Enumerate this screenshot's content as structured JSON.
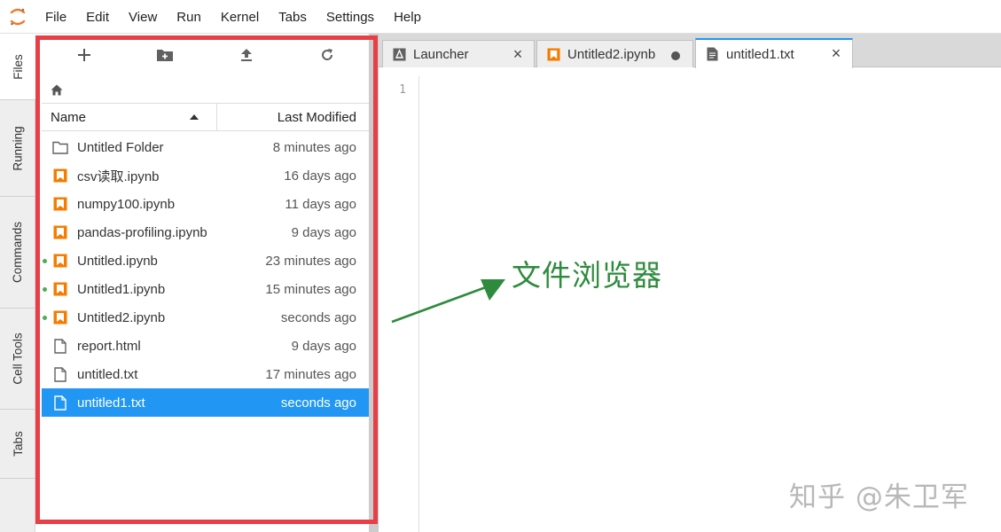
{
  "menubar": {
    "items": [
      "File",
      "Edit",
      "View",
      "Run",
      "Kernel",
      "Tabs",
      "Settings",
      "Help"
    ]
  },
  "left_tabs": [
    "Files",
    "Running",
    "Commands",
    "Cell Tools",
    "Tabs"
  ],
  "file_browser": {
    "columns": {
      "name": "Name",
      "modified": "Last Modified"
    },
    "files": [
      {
        "name": "Untitled Folder",
        "modified": "8 minutes ago",
        "type": "folder",
        "running": false,
        "selected": false
      },
      {
        "name": "csv读取.ipynb",
        "modified": "16 days ago",
        "type": "notebook",
        "running": false,
        "selected": false
      },
      {
        "name": "numpy100.ipynb",
        "modified": "11 days ago",
        "type": "notebook",
        "running": false,
        "selected": false
      },
      {
        "name": "pandas-profiling.ipynb",
        "modified": "9 days ago",
        "type": "notebook",
        "running": false,
        "selected": false
      },
      {
        "name": "Untitled.ipynb",
        "modified": "23 minutes ago",
        "type": "notebook",
        "running": true,
        "selected": false
      },
      {
        "name": "Untitled1.ipynb",
        "modified": "15 minutes ago",
        "type": "notebook",
        "running": true,
        "selected": false
      },
      {
        "name": "Untitled2.ipynb",
        "modified": "seconds ago",
        "type": "notebook",
        "running": true,
        "selected": false
      },
      {
        "name": "report.html",
        "modified": "9 days ago",
        "type": "file",
        "running": false,
        "selected": false
      },
      {
        "name": "untitled.txt",
        "modified": "17 minutes ago",
        "type": "file",
        "running": false,
        "selected": false
      },
      {
        "name": "untitled1.txt",
        "modified": "seconds ago",
        "type": "file",
        "running": false,
        "selected": true
      }
    ]
  },
  "tabs": [
    {
      "label": "Launcher",
      "icon": "launcher-icon"
    },
    {
      "label": "Untitled2.ipynb",
      "icon": "notebook-icon"
    },
    {
      "label": "untitled1.txt",
      "icon": "text-file-icon"
    }
  ],
  "editor": {
    "line_number": "1"
  },
  "annotation": {
    "text": "文件浏览器"
  },
  "watermark": {
    "text": "知乎 @朱卫军"
  },
  "colors": {
    "accent": "#2196f3",
    "highlight_border": "#e83e45",
    "notebook_icon": "#f57c00",
    "annotation": "#2e8b3d",
    "running_dot": "#4caf50"
  }
}
